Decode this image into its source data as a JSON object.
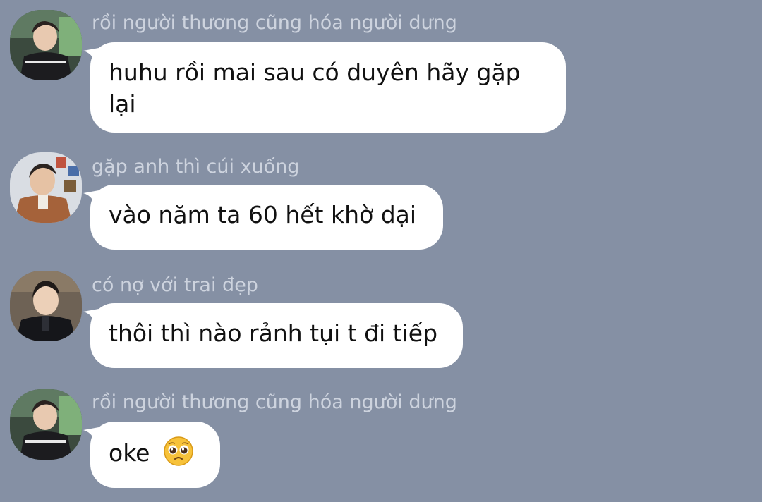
{
  "messages": [
    {
      "sender": "rồi người thương cũng hóa người dưng",
      "text": "huhu rồi mai sau có duyên hãy gặp lại",
      "avatar_icon": "user-avatar-icon"
    },
    {
      "sender": "gặp anh thì cúi xuống",
      "text": "vào năm ta 60 hết khờ dại",
      "avatar_icon": "user-avatar-icon"
    },
    {
      "sender": "có nợ với trai đẹp",
      "text": "thôi thì nào rảnh tụi t đi tiếp",
      "avatar_icon": "user-avatar-icon"
    },
    {
      "sender": "rồi người thương cũng hóa người dưng",
      "text": "oke",
      "emoji": "pleading-face-emoji",
      "avatar_icon": "user-avatar-icon"
    }
  ],
  "colors": {
    "background": "#8590a4",
    "bubble": "#ffffff",
    "sender_text": "#cdd3de",
    "message_text": "#111111"
  }
}
